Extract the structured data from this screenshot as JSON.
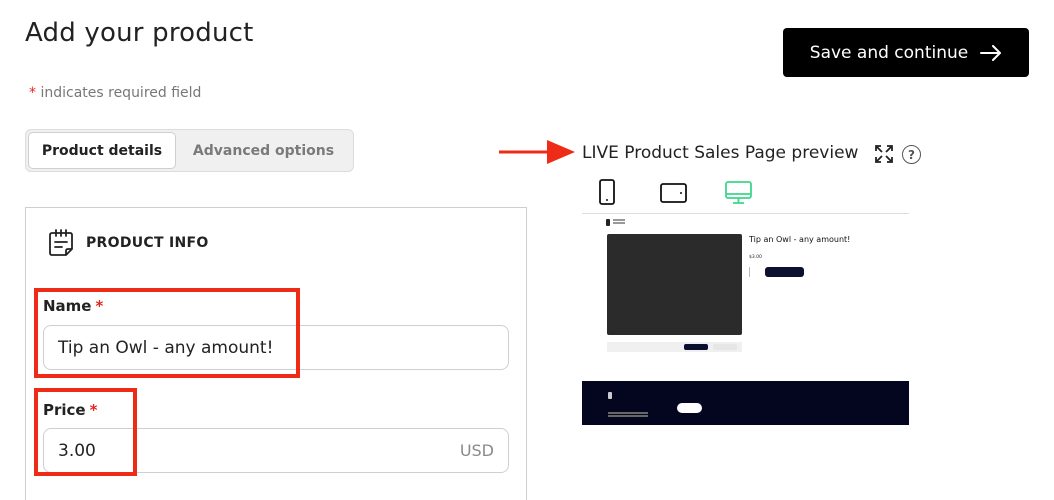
{
  "page": {
    "title": "Add your product",
    "save_label": "Save and continue",
    "required_star": "*",
    "required_note": "indicates required field"
  },
  "tabs": [
    {
      "label": "Product details",
      "active": true
    },
    {
      "label": "Advanced options",
      "active": false
    }
  ],
  "product_info": {
    "section_title": "PRODUCT INFO",
    "name_label": "Name",
    "name_value": "Tip an Owl - any amount!",
    "price_label": "Price",
    "price_value": "3.00",
    "currency": "USD",
    "required_star": "*"
  },
  "preview": {
    "title": "LIVE Product Sales Page preview",
    "help": "?",
    "devices": [
      "mobile-icon",
      "tablet-icon",
      "desktop-icon"
    ],
    "active_device": "desktop",
    "product_title": "Tip an Owl - any amount!",
    "product_price": "$3.00"
  },
  "colors": {
    "accent_red": "#ee2b16",
    "active_device": "#3dd68c",
    "button_bg": "#000000"
  }
}
